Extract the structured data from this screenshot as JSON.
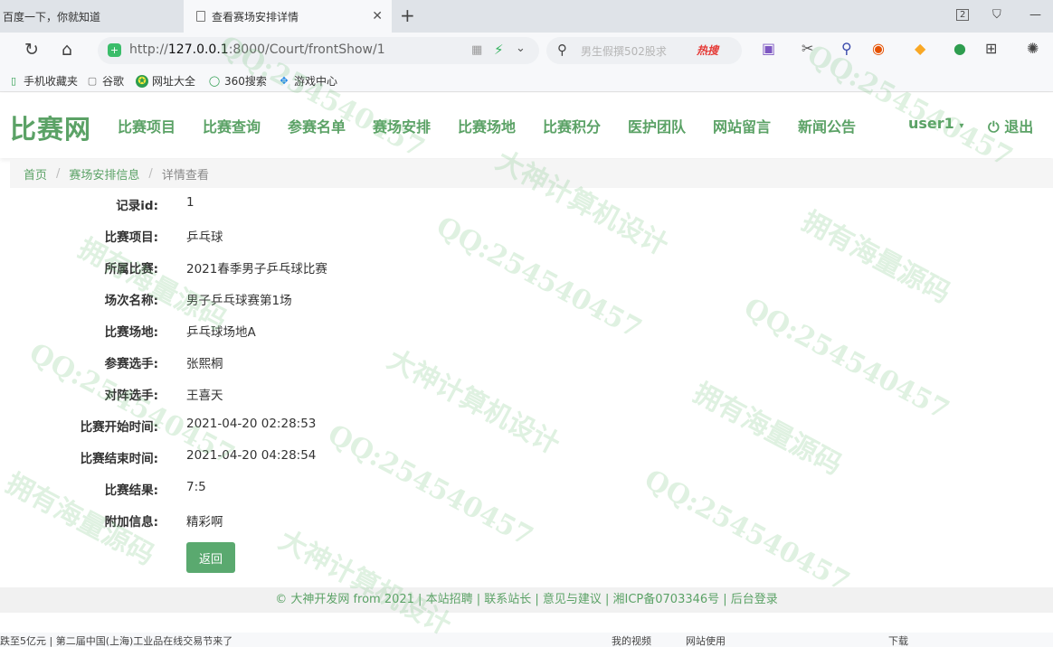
{
  "browser": {
    "tabs": [
      {
        "title": "百度一下，你就知道"
      },
      {
        "title": "查看赛场安排详情"
      }
    ],
    "url_prefix": "http://",
    "url_host": "127.0.0.1",
    "url_rest": ":8000/Court/frontShow/1",
    "search_placeholder": "男生假撰502股求",
    "hot_label": "热搜",
    "tab_count_badge": "2",
    "bookmarks": [
      "手机收藏夹",
      "谷歌",
      "网址大全",
      "360搜索",
      "游戏中心"
    ]
  },
  "site": {
    "logo": "比赛网",
    "menu": [
      "比赛项目",
      "比赛查询",
      "参赛名单",
      "赛场安排",
      "比赛场地",
      "比赛积分",
      "医护团队",
      "网站留言",
      "新闻公告"
    ],
    "user": "user1",
    "logout": "退出"
  },
  "breadcrumb": [
    "首页",
    "赛场安排信息",
    "详情查看"
  ],
  "record": {
    "fields": [
      {
        "label": "记录id:",
        "value": "1"
      },
      {
        "label": "比赛项目:",
        "value": "乒乓球"
      },
      {
        "label": "所属比赛:",
        "value": "2021春季男子乒乓球比赛"
      },
      {
        "label": "场次名称:",
        "value": "男子乒乓球赛第1场"
      },
      {
        "label": "比赛场地:",
        "value": "乒乓球场地A"
      },
      {
        "label": "参赛选手:",
        "value": "张熙桐"
      },
      {
        "label": "对阵选手:",
        "value": "王喜天"
      },
      {
        "label": "比赛开始时间:",
        "value": "2021-04-20 02:28:53"
      },
      {
        "label": "比赛结束时间:",
        "value": "2021-04-20 04:28:54"
      },
      {
        "label": "比赛结果:",
        "value": "7:5"
      },
      {
        "label": "附加信息:",
        "value": "精彩啊"
      }
    ],
    "back_label": "返回"
  },
  "footer": {
    "text": "© 大神开发网 from 2021 | 本站招聘 | 联系站长 | 意见与建议 | 湘ICP备0703346号 | 后台登录"
  },
  "statusbar": {
    "left": "跌至5亿元 | 第二届中国(上海)工业品在线交易节来了",
    "right_items": [
      "我的视频",
      "网站使用",
      "下载"
    ]
  },
  "watermarks": [
    "QQ:254540457",
    "大神计算机设计",
    "拥有海量源码"
  ],
  "colors": {
    "accent": "#5ba266",
    "button": "#5aa96f"
  }
}
